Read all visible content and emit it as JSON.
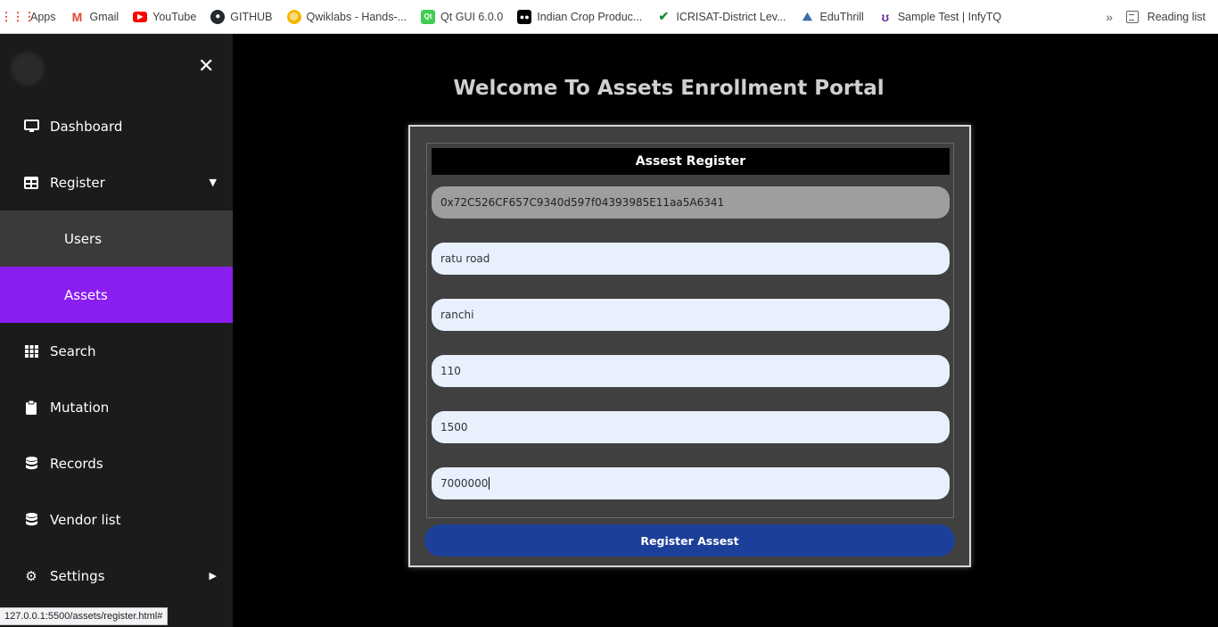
{
  "bookmarks": [
    {
      "label": "Apps",
      "icon": "apps-grid-icon",
      "color": "#ea4335"
    },
    {
      "label": "Gmail",
      "icon": "gmail-icon",
      "color": "#ea4335"
    },
    {
      "label": "YouTube",
      "icon": "youtube-icon",
      "color": "#ff0000"
    },
    {
      "label": "GITHUB",
      "icon": "github-icon",
      "color": "#24292e"
    },
    {
      "label": "Qwiklabs - Hands-...",
      "icon": "qwiklabs-icon",
      "color": "#f5b800"
    },
    {
      "label": "Qt GUI 6.0.0",
      "icon": "qt-icon",
      "color": "#41cd52"
    },
    {
      "label": "Indian Crop Produc...",
      "icon": "medium-icon",
      "color": "#000000"
    },
    {
      "label": "ICRISAT-District Lev...",
      "icon": "icrisat-icon",
      "color": "#1b8a3c"
    },
    {
      "label": "EduThrill",
      "icon": "eduthrill-icon",
      "color": "#3a6ea5"
    },
    {
      "label": "Sample Test | InfyTQ",
      "icon": "infytq-icon",
      "color": "#6b2fa0"
    }
  ],
  "reading_list": "Reading list",
  "sidebar": {
    "items": [
      {
        "label": "Dashboard",
        "icon": "monitor-icon"
      },
      {
        "label": "Register",
        "icon": "table-icon"
      },
      {
        "label": "Users",
        "icon": ""
      },
      {
        "label": "Assets",
        "icon": ""
      },
      {
        "label": "Search",
        "icon": "grid-icon"
      },
      {
        "label": "Mutation",
        "icon": "clipboard-icon"
      },
      {
        "label": "Records",
        "icon": "database-icon"
      },
      {
        "label": "Vendor list",
        "icon": "database-icon"
      },
      {
        "label": "Settings",
        "icon": "gears-icon"
      }
    ],
    "active_color": "#8a1ef0"
  },
  "status_url": "127.0.0.1:5500/assets/register.html#",
  "main": {
    "title": "Welcome To Assets Enrollment Portal",
    "form_title": "Assest Register",
    "fields": [
      {
        "value": "0x72C526CF657C9340d597f04393985E11aa5A6341",
        "disabled": true
      },
      {
        "value": "ratu road"
      },
      {
        "value": "ranchi"
      },
      {
        "value": "110"
      },
      {
        "value": "1500"
      },
      {
        "value": "7000000"
      }
    ],
    "submit_label": "Register Assest",
    "submit_color": "#1c3f9a"
  }
}
